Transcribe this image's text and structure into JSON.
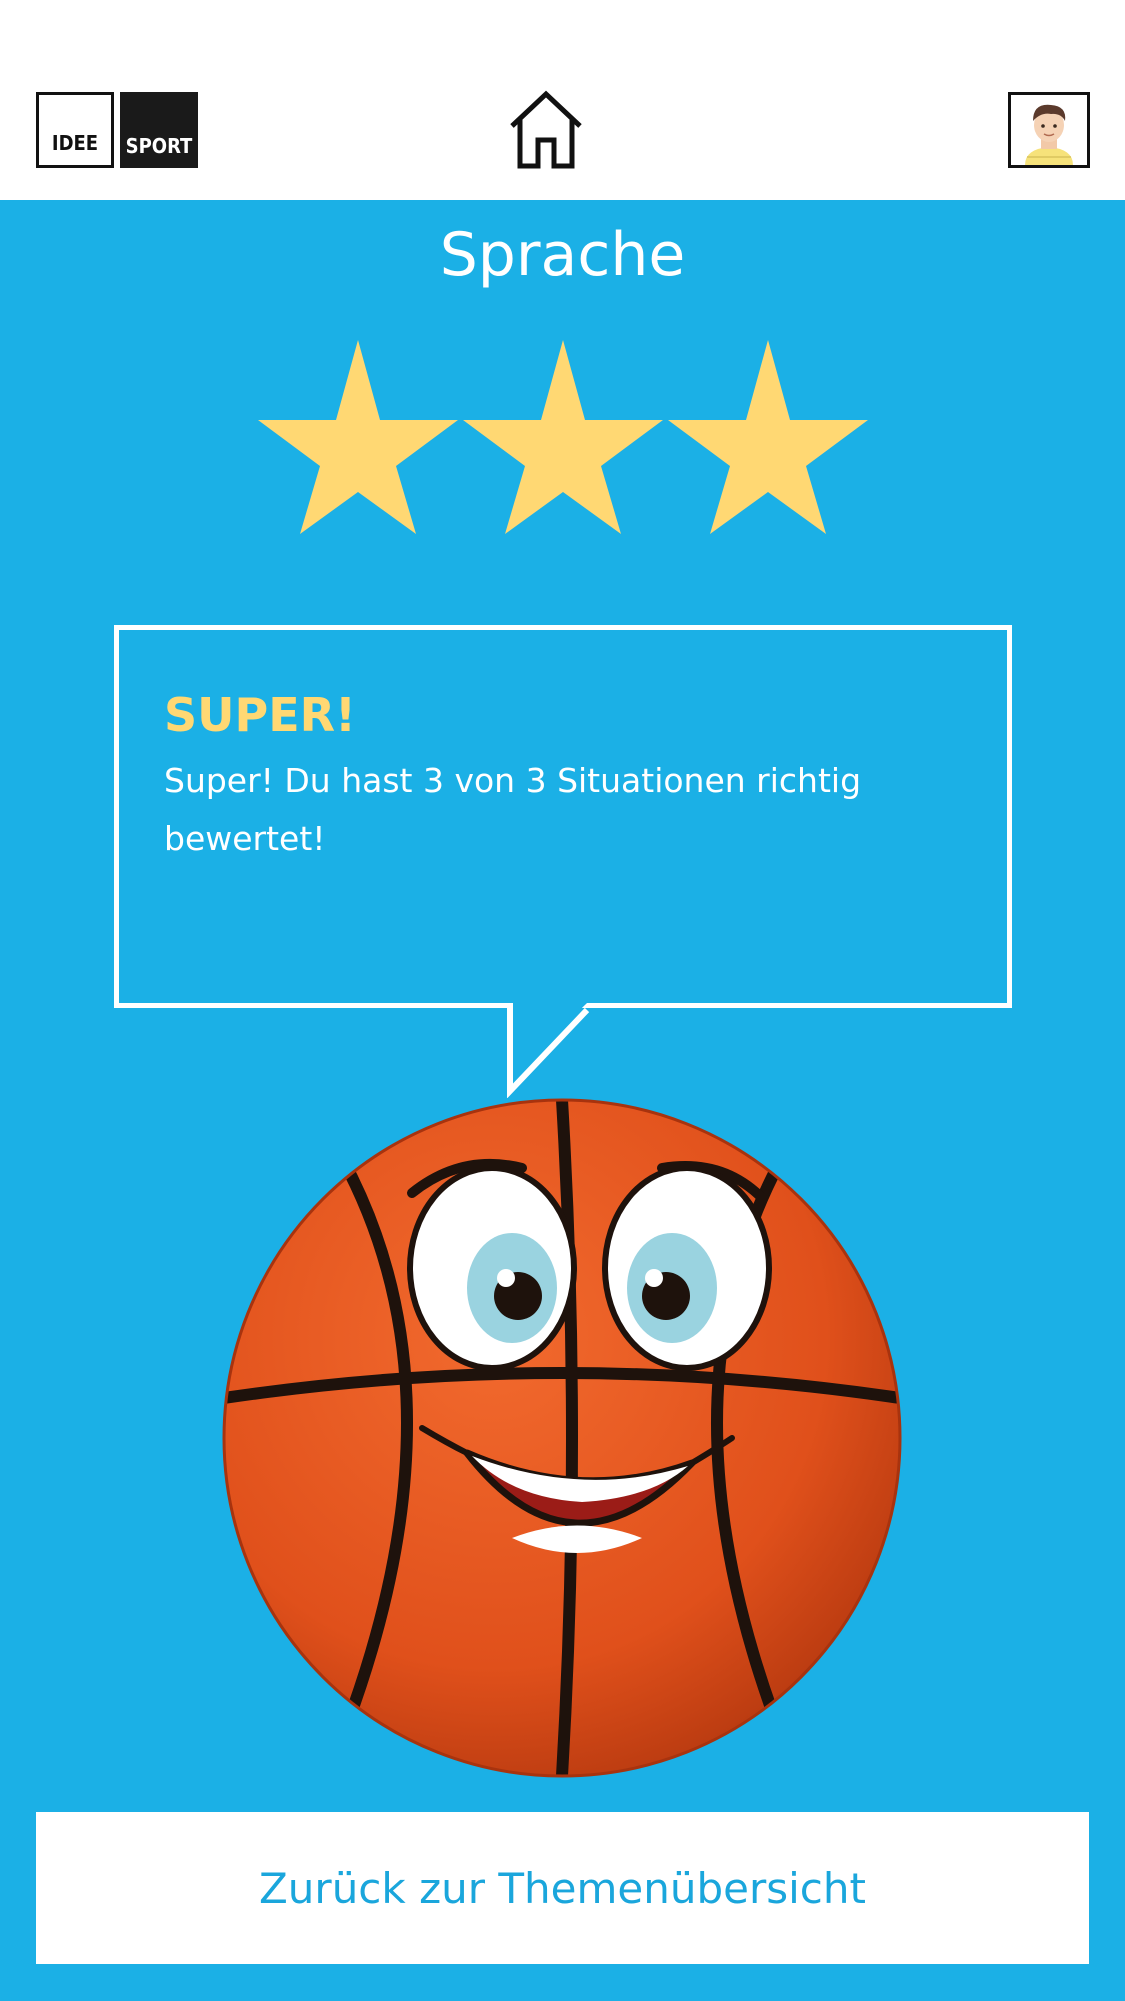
{
  "header": {
    "logo_left_text": "IDEE",
    "logo_right_text": "SPORT",
    "home_icon": "home-icon",
    "avatar_icon": "user-avatar-icon"
  },
  "main": {
    "title": "Sprache",
    "rating": {
      "value": 3,
      "max": 3
    },
    "star_color": "#ffd873",
    "background_color": "#1bb0e6",
    "feedback": {
      "heading": "SUPER!",
      "message": "Super! Du hast 3 von 3 Situationen richtig bewertet!"
    },
    "mascot": "basketball-mascot"
  },
  "footer": {
    "back_button_label": "Zurück zur Themenübersicht"
  }
}
